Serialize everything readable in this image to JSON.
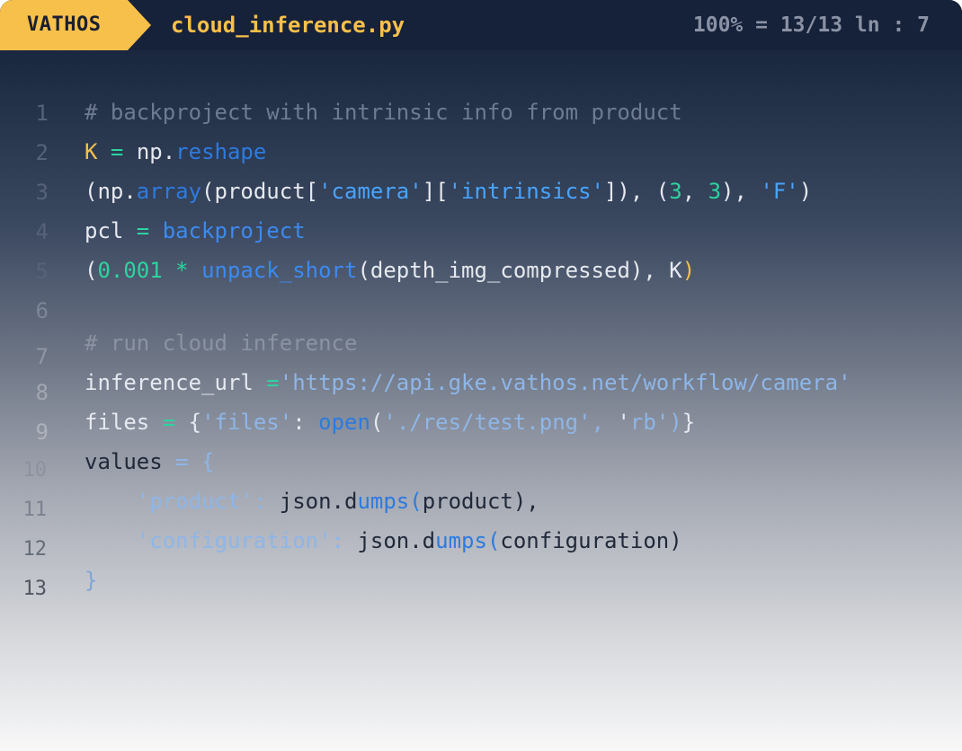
{
  "statusbar": {
    "brand": "VATHOS",
    "filename": "cloud_inference.py",
    "position": "100% = 13/13 ln : 7",
    "brand_color": "#f7c04a",
    "background_color": "#16213a"
  },
  "code": {
    "language": "python",
    "line_numbers": [
      "1",
      "2",
      "3",
      "4",
      "5",
      "6",
      "7",
      "8",
      "9",
      "10",
      "11",
      "12",
      "13"
    ],
    "lines": [
      "# backproject with intrinsic info from product",
      "K = np.reshape",
      "(np.array(product['camera']['intrinsics']), (3, 3), 'F')",
      "pcl = backproject",
      "(0.001 * unpack_short(depth_img_compressed), K)",
      "",
      "# run cloud inference",
      "inference_url ='https://api.gke.vathos.net/workflow/camera'",
      "files = {'files': open('./res/test.png', 'rb')}",
      "values = {",
      "    'product': json.dumps(product),",
      "    'configuration': json.dumps(configuration)",
      "}"
    ]
  },
  "colors": {
    "keyword_yellow": "#f7c04a",
    "function_blue": "#2c7be0",
    "string_blue": "#48a4ff",
    "number_green": "#2ed3a0",
    "comment_gray": "#6e7b92"
  }
}
